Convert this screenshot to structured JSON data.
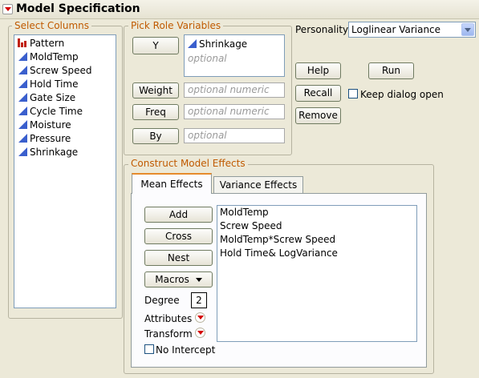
{
  "header": {
    "title": "Model Specification"
  },
  "select_columns": {
    "legend": "Select Columns",
    "items": [
      {
        "label": "Pattern",
        "type": "nominal"
      },
      {
        "label": "MoldTemp",
        "type": "continuous"
      },
      {
        "label": "Screw Speed",
        "type": "continuous"
      },
      {
        "label": "Hold Time",
        "type": "continuous"
      },
      {
        "label": "Gate Size",
        "type": "continuous"
      },
      {
        "label": "Cycle Time",
        "type": "continuous"
      },
      {
        "label": "Moisture",
        "type": "continuous"
      },
      {
        "label": "Pressure",
        "type": "continuous"
      },
      {
        "label": "Shrinkage",
        "type": "continuous"
      }
    ]
  },
  "pick_roles": {
    "legend": "Pick Role Variables",
    "y": {
      "button": "Y",
      "value": "Shrinkage",
      "placeholder": "optional"
    },
    "weight": {
      "button": "Weight",
      "placeholder": "optional numeric"
    },
    "freq": {
      "button": "Freq",
      "placeholder": "optional numeric"
    },
    "by": {
      "button": "By",
      "placeholder": "optional"
    }
  },
  "personality": {
    "label": "Personality:",
    "value": "Loglinear Variance"
  },
  "actions": {
    "help": "Help",
    "run": "Run",
    "recall": "Recall",
    "remove": "Remove",
    "keep_open": "Keep dialog open"
  },
  "construct": {
    "legend": "Construct Model Effects",
    "tabs": [
      "Mean Effects",
      "Variance Effects"
    ],
    "buttons": {
      "add": "Add",
      "cross": "Cross",
      "nest": "Nest",
      "macros": "Macros"
    },
    "degree_label": "Degree",
    "degree_value": "2",
    "attributes": "Attributes",
    "transform": "Transform",
    "no_intercept": "No Intercept",
    "effects": [
      "MoldTemp",
      "Screw Speed",
      "MoldTemp*Screw Speed",
      "Hold Time& LogVariance"
    ]
  }
}
